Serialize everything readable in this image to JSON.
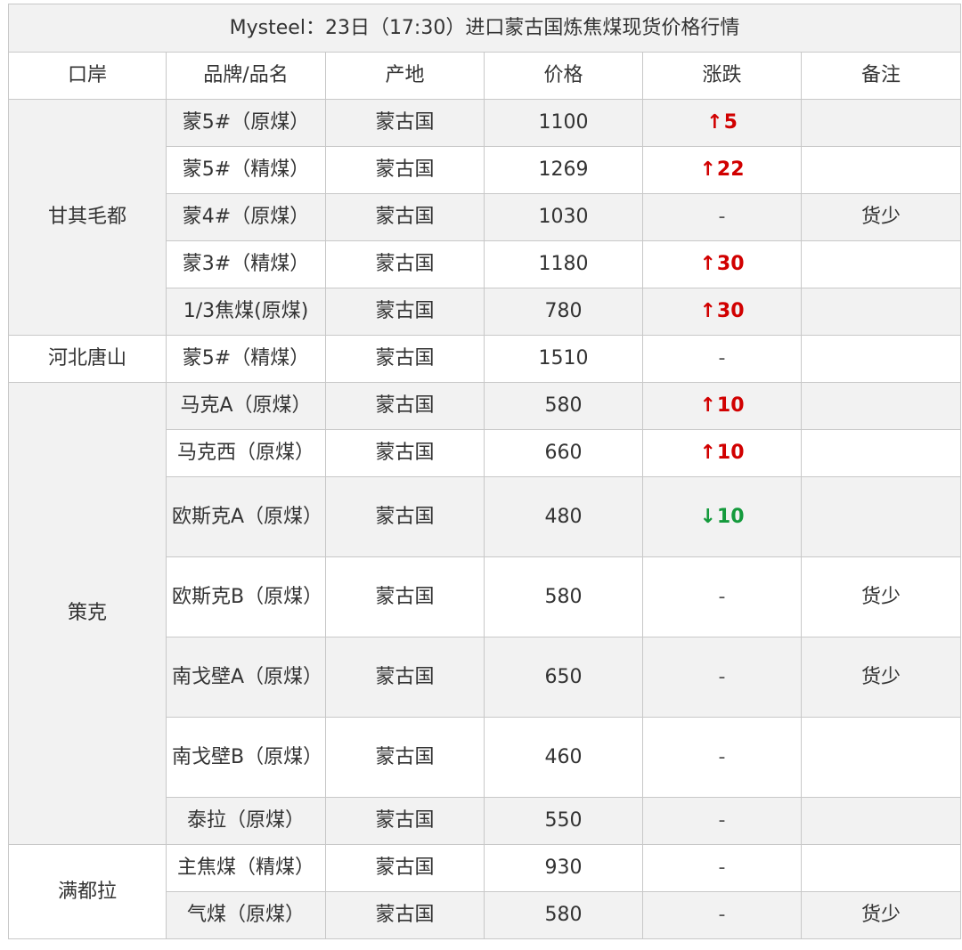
{
  "title": "Mysteel：23日（17:30）进口蒙古国炼焦煤现货价格行情",
  "headers": {
    "port": "口岸",
    "brand": "品牌/品名",
    "origin": "产地",
    "price": "价格",
    "change": "涨跌",
    "remark": "备注"
  },
  "ports": [
    {
      "name": "甘其毛都",
      "rows": [
        {
          "brand": "蒙5#（原煤）",
          "origin": "蒙古国",
          "price": "1100",
          "direction": "up",
          "change": "5",
          "remark": ""
        },
        {
          "brand": "蒙5#（精煤）",
          "origin": "蒙古国",
          "price": "1269",
          "direction": "up",
          "change": "22",
          "remark": ""
        },
        {
          "brand": "蒙4#（原煤）",
          "origin": "蒙古国",
          "price": "1030",
          "direction": "flat",
          "change": "-",
          "remark": "货少"
        },
        {
          "brand": "蒙3#（精煤）",
          "origin": "蒙古国",
          "price": "1180",
          "direction": "up",
          "change": "30",
          "remark": ""
        },
        {
          "brand": "1/3焦煤(原煤)",
          "origin": "蒙古国",
          "price": "780",
          "direction": "up",
          "change": "30",
          "remark": ""
        }
      ]
    },
    {
      "name": "河北唐山",
      "rows": [
        {
          "brand": "蒙5#（精煤）",
          "origin": "蒙古国",
          "price": "1510",
          "direction": "flat",
          "change": "-",
          "remark": ""
        }
      ]
    },
    {
      "name": "策克",
      "rows": [
        {
          "brand": "马克A（原煤）",
          "origin": "蒙古国",
          "price": "580",
          "direction": "up",
          "change": "10",
          "remark": ""
        },
        {
          "brand": "马克西（原煤）",
          "origin": "蒙古国",
          "price": "660",
          "direction": "up",
          "change": "10",
          "remark": ""
        },
        {
          "brand": "欧斯克A（原煤）",
          "origin": "蒙古国",
          "price": "480",
          "direction": "down",
          "change": "10",
          "remark": ""
        },
        {
          "brand": "欧斯克B（原煤）",
          "origin": "蒙古国",
          "price": "580",
          "direction": "flat",
          "change": "-",
          "remark": "货少"
        },
        {
          "brand": "南戈壁A（原煤）",
          "origin": "蒙古国",
          "price": "650",
          "direction": "flat",
          "change": "-",
          "remark": "货少"
        },
        {
          "brand": "南戈壁B（原煤）",
          "origin": "蒙古国",
          "price": "460",
          "direction": "flat",
          "change": "-",
          "remark": ""
        },
        {
          "brand": "泰拉（原煤）",
          "origin": "蒙古国",
          "price": "550",
          "direction": "flat",
          "change": "-",
          "remark": ""
        }
      ]
    },
    {
      "name": "满都拉",
      "rows": [
        {
          "brand": "主焦煤（精煤）",
          "origin": "蒙古国",
          "price": "930",
          "direction": "flat",
          "change": "-",
          "remark": ""
        },
        {
          "brand": "气煤（原煤）",
          "origin": "蒙古国",
          "price": "580",
          "direction": "flat",
          "change": "-",
          "remark": "货少"
        }
      ]
    }
  ],
  "symbols": {
    "up_arrow": "↑",
    "down_arrow": "↓"
  },
  "colors": {
    "up": "#d10000",
    "down": "#149a3c",
    "shade": "#f2f2f2",
    "border": "#c8c8c8"
  }
}
